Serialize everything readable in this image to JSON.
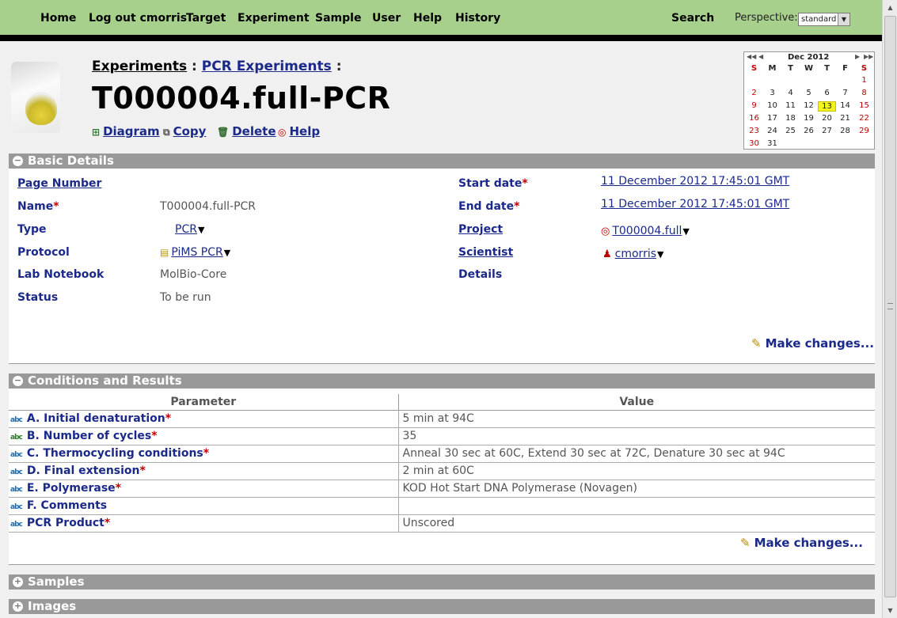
{
  "nav": {
    "items": [
      "Home",
      "Log out cmorris",
      "Target",
      "Experiment",
      "Sample",
      "User",
      "Help",
      "History"
    ],
    "search": "Search",
    "perspective_label": "Perspective:",
    "perspective_value": "standard"
  },
  "breadcrumb": {
    "first": "Experiments",
    "sep1": ":",
    "second": "PCR Experiments",
    "sep2": ":"
  },
  "title": "T000004.full-PCR",
  "actions": [
    "Diagram",
    "Copy",
    "Delete",
    "Help"
  ],
  "calendar": {
    "title": "Dec 2012",
    "dow": [
      "S",
      "M",
      "T",
      "W",
      "T",
      "F",
      "S"
    ],
    "weeks": [
      [
        "",
        "",
        "",
        "",
        "",
        "",
        "1"
      ],
      [
        "2",
        "3",
        "4",
        "5",
        "6",
        "7",
        "8"
      ],
      [
        "9",
        "10",
        "11",
        "12",
        "13",
        "14",
        "15"
      ],
      [
        "16",
        "17",
        "18",
        "19",
        "20",
        "21",
        "22"
      ],
      [
        "23",
        "24",
        "25",
        "26",
        "27",
        "28",
        "29"
      ],
      [
        "30",
        "31",
        "",
        "",
        "",
        "",
        ""
      ]
    ],
    "today": "13"
  },
  "basic": {
    "title": "Basic Details",
    "page_number_label": "Page Number",
    "name_label": "Name",
    "name_value": "T000004.full-PCR",
    "type_label": "Type",
    "type_value": "PCR",
    "protocol_label": "Protocol",
    "protocol_value": "PiMS PCR",
    "lab_notebook_label": "Lab Notebook",
    "lab_notebook_value": "MolBio-Core",
    "status_label": "Status",
    "status_value": "To be run",
    "start_label": "Start date",
    "start_value": "11 December 2012 17:45:01 GMT",
    "end_label": "End date",
    "end_value": "11 December 2012 17:45:01 GMT",
    "project_label": "Project",
    "project_value": "T000004.full",
    "scientist_label": "Scientist",
    "scientist_value": "cmorris",
    "details_label": "Details",
    "make_changes": "Make changes..."
  },
  "conditions": {
    "title": "Conditions and Results",
    "col_param": "Parameter",
    "col_value": "Value",
    "rows": [
      {
        "param": "A. Initial denaturation",
        "req": "*",
        "value": "5 min at 94C"
      },
      {
        "param": "B. Number of cycles",
        "req": "*",
        "value": "35"
      },
      {
        "param": "C. Thermocycling conditions",
        "req": "*",
        "value": "Anneal 30 sec at 60C, Extend 30 sec at 72C, Denature 30 sec at 94C"
      },
      {
        "param": "D. Final extension",
        "req": "*",
        "value": "2 min at 60C"
      },
      {
        "param": "E. Polymerase",
        "req": "*",
        "value": "KOD Hot Start DNA Polymerase (Novagen)"
      },
      {
        "param": "F. Comments",
        "req": "",
        "value": ""
      },
      {
        "param": "PCR Product",
        "req": "*",
        "value": "Unscored"
      }
    ],
    "make_changes": "Make changes..."
  },
  "samples": {
    "title": "Samples"
  },
  "images": {
    "title": "Images"
  },
  "required_mark": "*"
}
